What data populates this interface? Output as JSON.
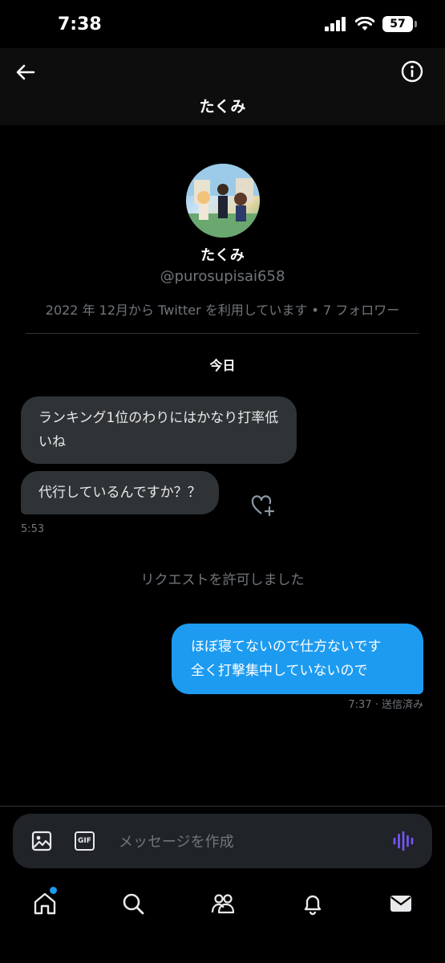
{
  "status_bar": {
    "time": "7:38",
    "battery": "57"
  },
  "header": {
    "title": "たくみ"
  },
  "profile": {
    "name": "たくみ",
    "handle": "@purosupisai658",
    "meta": "2022 年 12月から Twitter を利用しています • 7 フォロワー"
  },
  "conversation": {
    "day_label": "今日",
    "messages_in": [
      {
        "text": "ランキング1位のわりにはかなり打率低いね"
      },
      {
        "text": "代行しているんですか？？"
      }
    ],
    "in_timestamp": "5:53",
    "request_note": "リクエストを許可しました",
    "message_out": {
      "line1": "ほぼ寝てないので仕方ないです",
      "line2": "全く打撃集中していないので"
    },
    "out_status": "7:37 · 送信済み"
  },
  "composer": {
    "placeholder": "メッセージを作成",
    "gif_label": "GIF"
  },
  "nav": {
    "items": [
      "home-icon",
      "search-icon",
      "communities-icon",
      "notifications-icon",
      "messages-icon"
    ]
  },
  "colors": {
    "accent": "#1d9bf0",
    "voice": "#7856ff",
    "bubble_in": "#2f3336",
    "muted": "#71767b"
  }
}
